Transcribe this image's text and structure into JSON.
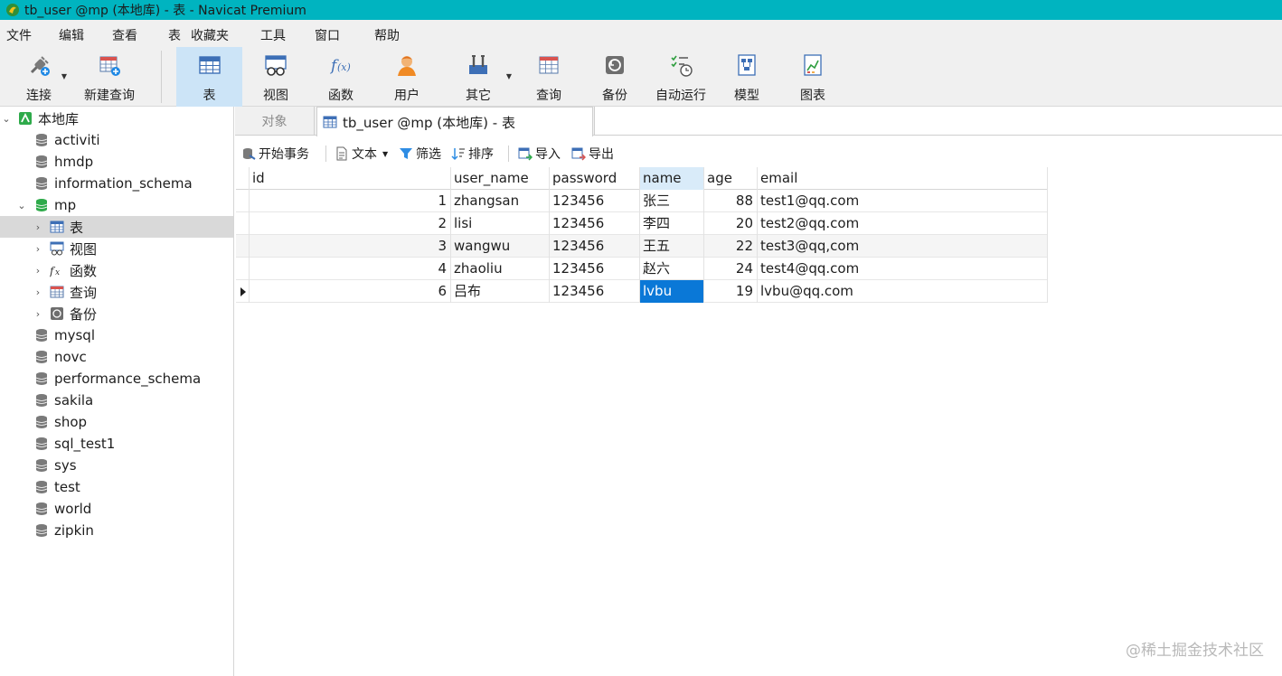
{
  "window": {
    "title": "tb_user @mp (本地库) - 表 - Navicat Premium"
  },
  "menu": [
    "文件",
    "编辑",
    "查看",
    "表",
    "收藏夹",
    "工具",
    "窗口",
    "帮助"
  ],
  "toolbar": [
    {
      "label": "连接",
      "icon": "plug-icon"
    },
    {
      "label": "新建查询",
      "icon": "new-query-icon"
    },
    {
      "label": "表",
      "icon": "table-icon",
      "active": true
    },
    {
      "label": "视图",
      "icon": "view-icon"
    },
    {
      "label": "函数",
      "icon": "function-icon"
    },
    {
      "label": "用户",
      "icon": "user-icon"
    },
    {
      "label": "其它",
      "icon": "tools-icon"
    },
    {
      "label": "查询",
      "icon": "query-icon"
    },
    {
      "label": "备份",
      "icon": "backup-icon"
    },
    {
      "label": "自动运行",
      "icon": "schedule-icon"
    },
    {
      "label": "模型",
      "icon": "model-icon"
    },
    {
      "label": "图表",
      "icon": "chart-icon"
    }
  ],
  "sidebar": {
    "connection": "本地库",
    "databases": [
      "activiti",
      "hmdp",
      "information_schema",
      "mp"
    ],
    "mp_children": [
      "表",
      "视图",
      "函数",
      "查询",
      "备份"
    ],
    "databases_after": [
      "mysql",
      "novc",
      "performance_schema",
      "sakila",
      "shop",
      "sql_test1",
      "sys",
      "test",
      "world",
      "zipkin"
    ]
  },
  "tabs": {
    "objects": "对象",
    "active": "tb_user @mp (本地库) - 表"
  },
  "subtoolbar": {
    "begin_transaction": "开始事务",
    "text": "文本",
    "filter": "筛选",
    "sort": "排序",
    "import": "导入",
    "export": "导出"
  },
  "table": {
    "columns": [
      "id",
      "user_name",
      "password",
      "name",
      "age",
      "email"
    ],
    "rows": [
      [
        "1",
        "zhangsan",
        "123456",
        "张三",
        "88",
        "test1@qq.com"
      ],
      [
        "2",
        "lisi",
        "123456",
        "李四",
        "20",
        "test2@qq.com"
      ],
      [
        "3",
        "wangwu",
        "123456",
        "王五",
        "22",
        "test3@qq,com"
      ],
      [
        "4",
        "zhaoliu",
        "123456",
        "赵六",
        "24",
        "test4@qq.com"
      ],
      [
        "6",
        "吕布",
        "123456",
        "lvbu",
        "19",
        "lvbu@qq.com"
      ]
    ]
  },
  "watermark": "@稀土掘金技术社区",
  "colors": {
    "titlebar": "#00b4c0",
    "selection": "#0a78d7",
    "active_tool": "#cce4f7"
  }
}
